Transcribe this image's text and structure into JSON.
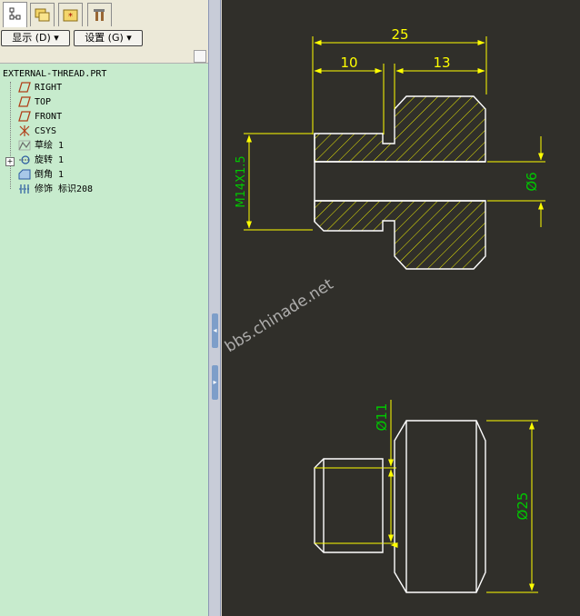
{
  "toolbar": {
    "tabs": [
      {
        "icon": "model-tree-icon",
        "active": true
      },
      {
        "icon": "folder-browser-icon",
        "active": false
      },
      {
        "icon": "favorites-icon",
        "active": false
      },
      {
        "icon": "connections-icon",
        "active": false
      }
    ],
    "display_label": "显示 (D) ▾",
    "settings_label": "设置 (G) ▾"
  },
  "tree": {
    "root": "EXTERNAL-THREAD.PRT",
    "items": [
      {
        "label": "RIGHT",
        "icon": "datum-plane-icon"
      },
      {
        "label": "TOP",
        "icon": "datum-plane-icon"
      },
      {
        "label": "FRONT",
        "icon": "datum-plane-icon"
      },
      {
        "label": "CSYS",
        "icon": "coordinate-system-icon"
      },
      {
        "label": "草绘 1",
        "icon": "sketch-icon"
      },
      {
        "label": "旋转 1",
        "icon": "revolve-icon",
        "expander": "+"
      },
      {
        "label": "倒角 1",
        "icon": "chamfer-icon"
      },
      {
        "label": "修饰 标识208",
        "icon": "cosmetic-icon"
      }
    ]
  },
  "drawing": {
    "section_view": {
      "dims": {
        "overall_length": "25",
        "thread_length": "10",
        "head_length": "13",
        "thread_callout": "M14X1.5",
        "bore_diameter": "Ø6"
      }
    },
    "side_view": {
      "dims": {
        "thread_diameter": "Ø11",
        "head_diameter": "Ø25"
      }
    },
    "watermark": "bbs.chinade.net",
    "colors": {
      "background": "#302f2a",
      "geometry": "#ffffff",
      "dimension": "#ffff00",
      "dim_text_green": "#00c800",
      "hatch": "#ffff00"
    }
  },
  "splitter": {
    "arrows": [
      "◂",
      "▸"
    ]
  }
}
